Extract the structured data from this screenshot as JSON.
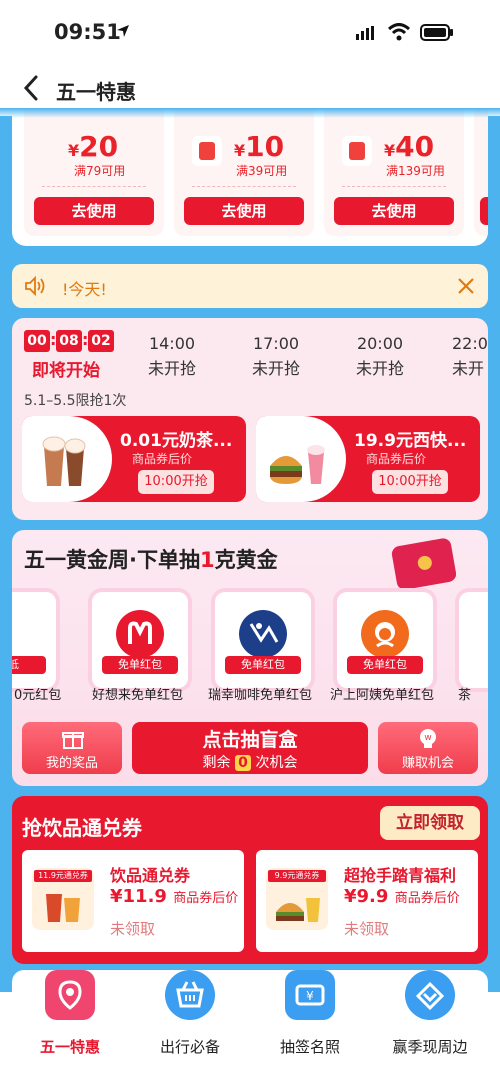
{
  "status": {
    "time": "09:51"
  },
  "nav": {
    "title": "五一特惠"
  },
  "coupons": [
    {
      "amount": "20",
      "condition": "满79可用",
      "button": "去使用"
    },
    {
      "amount": "10",
      "condition": "满39可用",
      "button": "去使用"
    },
    {
      "amount": "40",
      "condition": "满139可用",
      "button": "去使用"
    }
  ],
  "coupon_currency": "¥",
  "notice": {
    "text": "!今天!"
  },
  "flash": {
    "countdown": [
      "00",
      "08",
      "02"
    ],
    "countdown_label": "即将开始",
    "slots": [
      {
        "time": "14:00",
        "status": "未开抢"
      },
      {
        "time": "17:00",
        "status": "未开抢"
      },
      {
        "time": "20:00",
        "status": "未开抢"
      },
      {
        "time": "22:0",
        "status": "未开"
      }
    ],
    "limit": "5.1–5.5限抢1次",
    "deals": [
      {
        "title": "0.01元奶茶...",
        "subtitle": "商品券后价",
        "button": "10:00开抢"
      },
      {
        "title": "19.9元西快...",
        "subtitle": "商品券后价",
        "button": "10:00开抢"
      }
    ]
  },
  "gold": {
    "title_a": "五一黄金周·下单抽",
    "title_hl": "1",
    "title_b": "克黄金",
    "prizes": [
      {
        "label": "0元红包",
        "tag": "元抵"
      },
      {
        "label": "好想来免单红包",
        "tag": "免单红包"
      },
      {
        "label": "瑞幸咖啡免单红包",
        "tag": "免单红包"
      },
      {
        "label": "沪上阿姨免单红包",
        "tag": "免单红包"
      },
      {
        "label": "茶",
        "tag": ""
      }
    ],
    "my_prizes": "我的奖品",
    "draw_label": "点击抽盲盒",
    "remain_prefix": "剩余",
    "remain_count": "0",
    "remain_suffix": "次机会",
    "earn": "赚取机会"
  },
  "drinks": {
    "title": "抢饮品通兑券",
    "get_all": "立即领取",
    "cards": [
      {
        "mini": "11.9元通兑券",
        "name": "饮品通兑券",
        "price": "11.9",
        "price_note": "商品券后价",
        "state": "未领取"
      },
      {
        "mini": "9.9元通兑券",
        "name": "超抢手踏青福利",
        "price": "9.9",
        "price_note": "商品券后价",
        "state": "未领取"
      }
    ]
  },
  "tabs": [
    {
      "label": "五一特惠",
      "icon": "location-pin-icon"
    },
    {
      "label": "出行必备",
      "icon": "basket-icon"
    },
    {
      "label": "抽签名照",
      "icon": "ticket-icon"
    },
    {
      "label": "赢季现周边",
      "icon": "heart-diamond-icon"
    }
  ],
  "colors": {
    "accent": "#e8192f",
    "background": "#4db3ee",
    "notice_bg": "#fef3d9"
  }
}
